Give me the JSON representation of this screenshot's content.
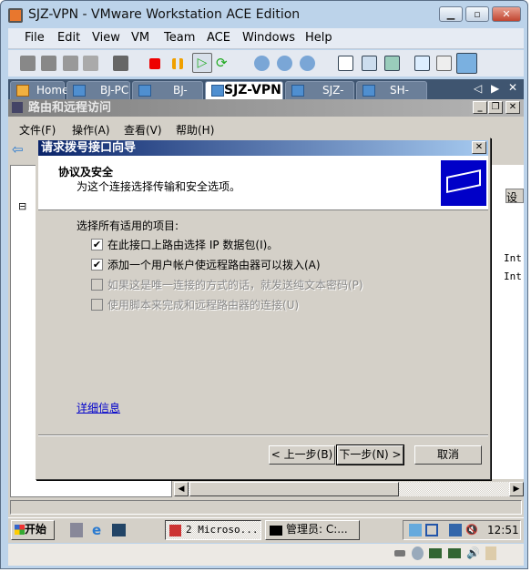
{
  "window": {
    "title": "SJZ-VPN - VMware Workstation ACE Edition",
    "minimize": "▁",
    "restore": "▫",
    "close": "✕"
  },
  "menu": [
    "File",
    "Edit",
    "View",
    "VM",
    "Team",
    "ACE",
    "Windows",
    "Help"
  ],
  "tabs": [
    {
      "label": "Home"
    },
    {
      "label": "BJ-PC"
    },
    {
      "label": "BJ-VPN"
    },
    {
      "label": "SJZ-VPN",
      "active": true
    },
    {
      "label": "SJZ-PC"
    },
    {
      "label": "SH-VPN"
    }
  ],
  "tab_nav": {
    "prev": "◁",
    "next": "▶",
    "close": "✕"
  },
  "mmc": {
    "title": "路由和远程访问",
    "menu": [
      "文件(F)",
      "操作(A)",
      "查看(V)",
      "帮助(H)"
    ],
    "col_header": "设",
    "rows": [
      "Int",
      "Int"
    ]
  },
  "wizard": {
    "title": "请求拨号接口向导",
    "close": "✕",
    "header_title": "协议及安全",
    "header_subtitle": "为这个连接选择传输和安全选项。",
    "prompt": "选择所有适用的项目:",
    "options": [
      {
        "label": "在此接口上路由选择 IP 数据包(I)。",
        "checked": true,
        "enabled": true
      },
      {
        "label": "添加一个用户帐户使远程路由器可以拨入(A)",
        "checked": true,
        "enabled": true
      },
      {
        "label": "如果这是唯一连接的方式的话，就发送纯文本密码(P)",
        "checked": false,
        "enabled": false
      },
      {
        "label": "使用脚本来完成和远程路由器的连接(U)",
        "checked": false,
        "enabled": false
      }
    ],
    "details_link": "详细信息",
    "back": "< 上一步(B)",
    "next": "下一步(N) >",
    "cancel": "取消"
  },
  "taskbar": {
    "start": "开始",
    "tasks": [
      "2 Microso...",
      "管理员: C:..."
    ],
    "clock": "12:51"
  },
  "colors": {
    "dialog_title_start": "#0a246a",
    "dialog_title_end": "#a6caf0",
    "tabbar": "#3f5570"
  }
}
